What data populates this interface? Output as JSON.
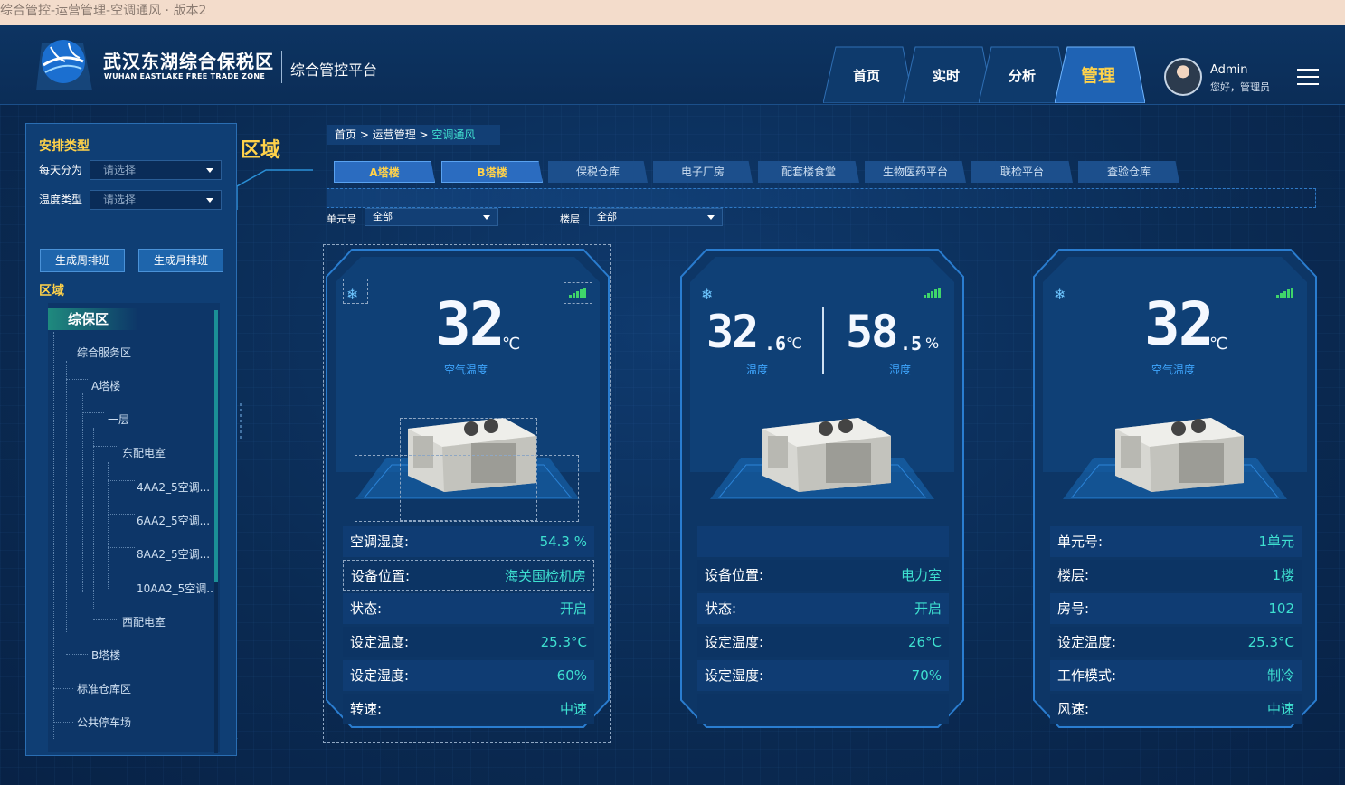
{
  "browser": {
    "title": "综合管控-运营管理-空调通风 · 版本2"
  },
  "header": {
    "brand_cn": "武汉东湖综合保税区",
    "brand_en": "WUHAN EASTLAKE FREE TRADE ZONE",
    "platform": "综合管控平台",
    "nav": [
      "首页",
      "实时",
      "分析",
      "管理"
    ],
    "active_nav": "管理",
    "user_name": "Admin",
    "user_greeting": "您好，管理员"
  },
  "left": {
    "schedule_title": "安排类型",
    "region_big": "区域",
    "per_day_label": "每天分为",
    "per_day_placeholder": "请选择",
    "temp_type_label": "温度类型",
    "temp_type_placeholder": "请选择",
    "btn_week": "生成周排班",
    "btn_month": "生成月排班",
    "area_title": "区域",
    "tree": {
      "root": "综保区",
      "nodes": [
        "综合服务区",
        "A塔楼",
        "一层",
        "东配电室",
        "4AA2_5空调...",
        "6AA2_5空调...",
        "8AA2_5空调...",
        "10AA2_5空调..",
        "西配电室",
        "B塔楼",
        "标准仓库区",
        "公共停车场"
      ]
    }
  },
  "main": {
    "breadcrumb": {
      "home": "首页",
      "sep1": " > ",
      "ops": "运营管理",
      "sep2": " > ",
      "current": "空调通风"
    },
    "tabs": [
      "A塔楼",
      "B塔楼",
      "保税仓库",
      "电子厂房",
      "配套楼食堂",
      "生物医药平台",
      "联检平台",
      "查验仓库"
    ],
    "filters": {
      "unit_label": "单元号",
      "unit_value": "全部",
      "floor_label": "楼层",
      "floor_value": "全部"
    }
  },
  "cards": [
    {
      "temp_int": "32",
      "temp_unit": "℃",
      "caption": "空气温度",
      "rows": [
        {
          "k": "空调湿度:",
          "v": "54.3 %"
        },
        {
          "k": "设备位置:",
          "v": "海关国检机房"
        },
        {
          "k": "状态:",
          "v": "开启"
        },
        {
          "k": "设定温度:",
          "v": "25.3°C"
        },
        {
          "k": "设定湿度:",
          "v": "60%"
        },
        {
          "k": "转速:",
          "v": "中速"
        }
      ]
    },
    {
      "temp_int": "32",
      "temp_dec": ".6",
      "temp_unit": "℃",
      "temp_caption": "温度",
      "hum_int": "58",
      "hum_dec": ".5",
      "hum_unit": "%",
      "hum_caption": "湿度",
      "rows": [
        {
          "k": "",
          "v": ""
        },
        {
          "k": "设备位置:",
          "v": "电力室"
        },
        {
          "k": "状态:",
          "v": "开启"
        },
        {
          "k": "设定温度:",
          "v": "26°C"
        },
        {
          "k": "设定湿度:",
          "v": "70%"
        },
        {
          "k": "",
          "v": ""
        }
      ]
    },
    {
      "temp_int": "32",
      "temp_unit": "℃",
      "caption": "空气温度",
      "rows": [
        {
          "k": "单元号:",
          "v": "1单元"
        },
        {
          "k": "楼层:",
          "v": "1楼"
        },
        {
          "k": "房号:",
          "v": "102"
        },
        {
          "k": "设定温度:",
          "v": "25.3°C"
        },
        {
          "k": "工作模式:",
          "v": "制冷"
        },
        {
          "k": "风速:",
          "v": "中速"
        }
      ]
    }
  ],
  "icons": {
    "snow": "snowflake-icon",
    "signal": "signal-icon",
    "menu": "hamburger-menu-icon"
  },
  "colors": {
    "accent_yellow": "#ffd24a",
    "accent_cyan": "#3ee0d0",
    "signal_green": "#3fd56a"
  }
}
